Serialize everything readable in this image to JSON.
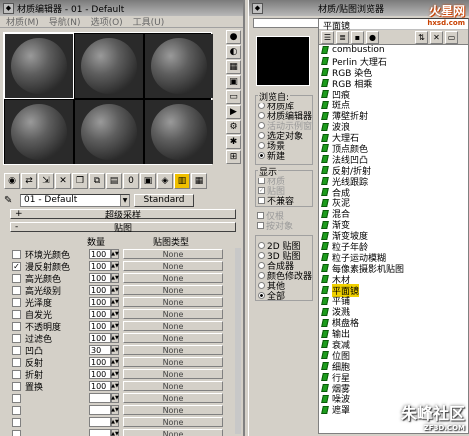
{
  "editor": {
    "title": "材质编辑器 - 01 - Default",
    "menu": [
      "材质(M)",
      "导航(N)",
      "选项(O)",
      "工具(U)"
    ],
    "material_name": "01 - Default",
    "type_button": "Standard",
    "rollout_super": "超级采样",
    "rollout_maps": "贴图",
    "sign_super": "+",
    "sign_maps": "-",
    "col_amount": "数量",
    "col_maptype": "贴图类型",
    "maps": [
      {
        "label": "环境光颜色",
        "checked": false,
        "amount": "100",
        "map": "None",
        "dim": false
      },
      {
        "label": "漫反射颜色",
        "checked": true,
        "amount": "100",
        "map": "None",
        "dim": false
      },
      {
        "label": "高光颜色",
        "checked": false,
        "amount": "100",
        "map": "None",
        "dim": false
      },
      {
        "label": "高光级别",
        "checked": false,
        "amount": "100",
        "map": "None",
        "dim": false
      },
      {
        "label": "光泽度",
        "checked": false,
        "amount": "100",
        "map": "None",
        "dim": false
      },
      {
        "label": "自发光",
        "checked": false,
        "amount": "100",
        "map": "None",
        "dim": false
      },
      {
        "label": "不透明度",
        "checked": false,
        "amount": "100",
        "map": "None",
        "dim": false
      },
      {
        "label": "过滤色",
        "checked": false,
        "amount": "100",
        "map": "None",
        "dim": false
      },
      {
        "label": "凹凸",
        "checked": false,
        "amount": "30",
        "map": "None",
        "dim": false
      },
      {
        "label": "反射",
        "checked": false,
        "amount": "100",
        "map": "None",
        "dim": false
      },
      {
        "label": "折射",
        "checked": false,
        "amount": "100",
        "map": "None",
        "dim": false
      },
      {
        "label": "置换",
        "checked": false,
        "amount": "100",
        "map": "None",
        "dim": false
      },
      {
        "label": "",
        "checked": false,
        "amount": "",
        "map": "None",
        "dim": true
      },
      {
        "label": "",
        "checked": false,
        "amount": "",
        "map": "None",
        "dim": true
      },
      {
        "label": "",
        "checked": false,
        "amount": "",
        "map": "None",
        "dim": true
      },
      {
        "label": "",
        "checked": false,
        "amount": "",
        "map": "None",
        "dim": true
      }
    ]
  },
  "browser": {
    "title": "材质/贴图浏览器",
    "list_header": "平面镜",
    "browse_from_label": "浏览自:",
    "browse_from": [
      {
        "label": "材质库",
        "on": false,
        "dim": false
      },
      {
        "label": "材质编辑器",
        "on": false,
        "dim": false
      },
      {
        "label": "活动示例窗",
        "on": false,
        "dim": true
      },
      {
        "label": "选定对象",
        "on": false,
        "dim": false
      },
      {
        "label": "场景",
        "on": false,
        "dim": false
      },
      {
        "label": "新建",
        "on": true,
        "dim": false
      }
    ],
    "show_label": "显示",
    "show": [
      {
        "label": "材质",
        "checked": false,
        "dim": true
      },
      {
        "label": "贴图",
        "checked": true,
        "dim": true
      },
      {
        "label": "不兼容",
        "checked": false,
        "dim": false
      }
    ],
    "extra": [
      {
        "label": "仅根",
        "checked": false,
        "dim": true
      },
      {
        "label": "按对象",
        "checked": false,
        "dim": true
      }
    ],
    "filter": [
      {
        "label": "2D 贴图",
        "on": false
      },
      {
        "label": "3D 贴图",
        "on": false
      },
      {
        "label": "合成器",
        "on": false
      },
      {
        "label": "颜色修改器",
        "on": false
      },
      {
        "label": "其他",
        "on": false
      },
      {
        "label": "全部",
        "on": true
      }
    ],
    "maps": [
      "combustion",
      "Perlin 大理石",
      "RGB 染色",
      "RGB 相乘",
      "凹痕",
      "斑点",
      "薄壁折射",
      "波浪",
      "大理石",
      "顶点颜色",
      "法线凹凸",
      "反射/折射",
      "光线跟踪",
      "合成",
      "灰泥",
      "混合",
      "渐变",
      "渐变坡度",
      "粒子年龄",
      "粒子运动模糊",
      "每像素摄影机贴图",
      "木材",
      "平面镜",
      "平铺",
      "泼溅",
      "棋盘格",
      "输出",
      "衰减",
      "位图",
      "细胞",
      "行星",
      "烟雾",
      "噪波",
      "遮罩"
    ],
    "selected_index": 22
  },
  "watermarks": {
    "top": "火星网",
    "top_small": "hxsd.com",
    "bottom": "朱峰社区",
    "bottom_small": "ZF3D.COM"
  }
}
